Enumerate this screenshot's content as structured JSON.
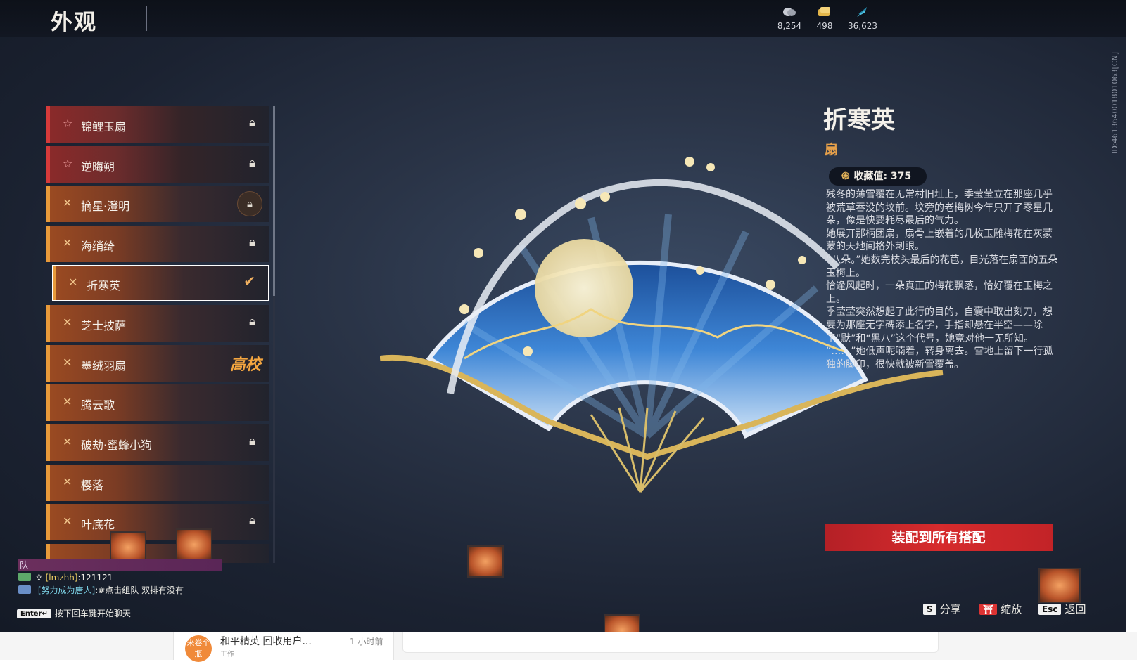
{
  "header": {
    "title": "外观",
    "currencies": [
      {
        "icon": "coin-icon",
        "value": "8,254"
      },
      {
        "icon": "gold-ticket-icon",
        "value": "498"
      },
      {
        "icon": "feather-icon",
        "value": "36,623"
      }
    ]
  },
  "player_id": "ID:461364001801063[CN]",
  "items": [
    {
      "name": "锦鲤玉扇",
      "rarity": "red",
      "state": "locked"
    },
    {
      "name": "逆晦朔",
      "rarity": "red",
      "state": "locked"
    },
    {
      "name": "摘星·澄明",
      "rarity": "orange",
      "state": "locked-circle"
    },
    {
      "name": "海绡绮",
      "rarity": "orange",
      "state": "locked"
    },
    {
      "name": "折寒英",
      "rarity": "orange",
      "state": "equipped"
    },
    {
      "name": "芝士披萨",
      "rarity": "orange",
      "state": "locked"
    },
    {
      "name": "墨绒羽扇",
      "rarity": "orange",
      "state": "高校"
    },
    {
      "name": "腾云歌",
      "rarity": "orange",
      "state": "none"
    },
    {
      "name": "破劫·蜜蜂小狗",
      "rarity": "orange",
      "state": "locked"
    },
    {
      "name": "樱落",
      "rarity": "orange",
      "state": "none"
    },
    {
      "name": "叶底花",
      "rarity": "orange",
      "state": "locked"
    }
  ],
  "detail": {
    "title": "折寒英",
    "type": "扇",
    "collection_label": "收藏值: 375",
    "description": [
      "残冬的薄雪覆在无常村旧址上，季莹莹立在那座几乎被荒草吞没的坟前。坟旁的老梅树今年只开了零星几朵，像是快要耗尽最后的气力。",
      "她展开那柄团扇，扇骨上嵌着的几枚玉雕梅花在灰蒙蒙的天地间格外刺眼。",
      "“八朵。”她数完枝头最后的花苞，目光落在扇面的五朵玉梅上。",
      "恰逢风起时，一朵真正的梅花飘落，恰好覆在玉梅之上。",
      "季莹莹突然想起了此行的目的，自囊中取出刻刀，想要为那座无字碑添上名字，手指却悬在半空——除了“默”和“黑八”这个代号，她竟对他一无所知。",
      "“……”她低声呢喃着，转身离去。雪地上留下一行孤独的脚印，很快就被新雪覆盖。"
    ],
    "equip_button": "装配到所有搭配"
  },
  "hints": [
    {
      "key": "S",
      "label": "分享"
    },
    {
      "key": "⛩",
      "label": "缩放"
    },
    {
      "key": "Esc",
      "label": "返回"
    }
  ],
  "chat": {
    "bar": "队",
    "lines": [
      {
        "name": "[lmzhh]",
        "text": ":121121"
      },
      {
        "name": "[努力成为唐人]",
        "text": ":#点击组队 双排有没有"
      }
    ],
    "input_key": "Enter↵",
    "input_hint": "按下回车键开始聊天"
  },
  "browser": {
    "avatar_text": "来卷个瓶",
    "title": "和平精英 回收用户...",
    "time": "1 小时前",
    "sub": "工作"
  },
  "colors": {
    "accent_orange": "#e89a3a",
    "accent_red": "#d63a3a",
    "button_red": "#d62b2d"
  }
}
